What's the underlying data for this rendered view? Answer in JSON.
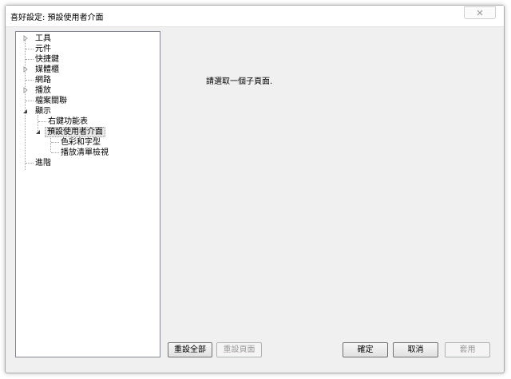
{
  "window": {
    "title": "喜好設定: 預設使用者介面"
  },
  "tree": {
    "items": [
      {
        "label": "工具"
      },
      {
        "label": "元件"
      },
      {
        "label": "快捷鍵"
      },
      {
        "label": "媒體櫃"
      },
      {
        "label": "網路"
      },
      {
        "label": "播放"
      },
      {
        "label": "檔案關聯"
      },
      {
        "label": "顯示"
      },
      {
        "label": "右鍵功能表"
      },
      {
        "label": "預設使用者介面"
      },
      {
        "label": "色彩和字型"
      },
      {
        "label": "播放清單檢視"
      },
      {
        "label": "進階"
      }
    ]
  },
  "content": {
    "message": "請選取一個子頁面."
  },
  "buttons": {
    "reset_all": "重設全部",
    "reset_page": "重設頁面",
    "ok": "確定",
    "cancel": "取消",
    "apply": "套用"
  }
}
